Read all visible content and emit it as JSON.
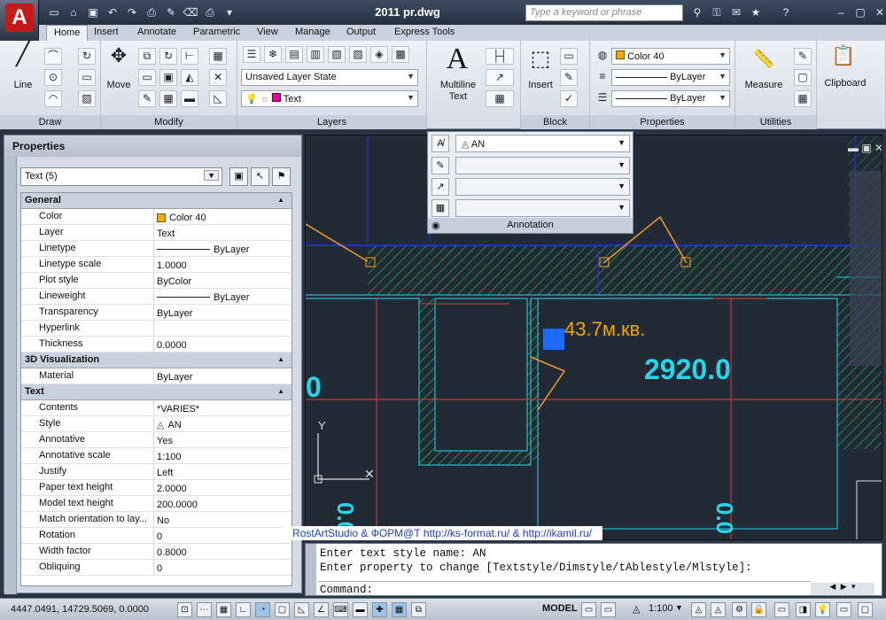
{
  "title": {
    "doc": "2011 pr.dwg",
    "search_placeholder": "Type a keyword or phrase"
  },
  "tabs": [
    {
      "label": "Home",
      "active": true
    },
    {
      "label": "Insert"
    },
    {
      "label": "Annotate"
    },
    {
      "label": "Parametric"
    },
    {
      "label": "View"
    },
    {
      "label": "Manage"
    },
    {
      "label": "Output"
    },
    {
      "label": "Express Tools"
    }
  ],
  "ribbon": {
    "draw": {
      "title": "Draw",
      "line_label": "Line"
    },
    "modify": {
      "title": "Modify",
      "move_label": "Move"
    },
    "layers": {
      "title": "Layers",
      "layer_state": "Unsaved Layer State",
      "current_layer": "Text",
      "current_layer_color": "#e000a0"
    },
    "annotation": {
      "multiline_label_1": "Multiline",
      "multiline_label_2": "Text"
    },
    "block": {
      "title": "Block",
      "insert_label": "Insert"
    },
    "properties": {
      "title": "Properties",
      "color": "Color 40",
      "color_swatch": "#f0a800",
      "linetype": "ByLayer",
      "lineweight": "ByLayer"
    },
    "utilities": {
      "title": "Utilities",
      "measure_label": "Measure"
    },
    "clipboard": {
      "title": "Clipboard"
    }
  },
  "annotation_panel": {
    "title": "Annotation",
    "text_style": "AN",
    "rows": [
      "AN",
      "",
      "",
      ""
    ]
  },
  "properties_palette": {
    "title": "Properties",
    "selection": "Text (5)",
    "sections": [
      {
        "name": "General",
        "rows": [
          {
            "k": "Color",
            "v": "Color 40",
            "swatch": true
          },
          {
            "k": "Layer",
            "v": "Text"
          },
          {
            "k": "Linetype",
            "v": "ByLayer",
            "line": true
          },
          {
            "k": "Linetype scale",
            "v": "1.0000"
          },
          {
            "k": "Plot style",
            "v": "ByColor"
          },
          {
            "k": "Lineweight",
            "v": "ByLayer",
            "line": true
          },
          {
            "k": "Transparency",
            "v": "ByLayer"
          },
          {
            "k": "Hyperlink",
            "v": ""
          },
          {
            "k": "Thickness",
            "v": "0.0000"
          }
        ]
      },
      {
        "name": "3D Visualization",
        "rows": [
          {
            "k": "Material",
            "v": "ByLayer"
          }
        ]
      },
      {
        "name": "Text",
        "rows": [
          {
            "k": "Contents",
            "v": "*VARIES*"
          },
          {
            "k": "Style",
            "v": "AN",
            "anno": true
          },
          {
            "k": "Annotative",
            "v": "Yes"
          },
          {
            "k": "Annotative scale",
            "v": "1:100"
          },
          {
            "k": "Justify",
            "v": "Left"
          },
          {
            "k": "Paper text height",
            "v": "2.0000"
          },
          {
            "k": "Model text height",
            "v": "200.0000"
          },
          {
            "k": "Match orientation to lay...",
            "v": "No"
          },
          {
            "k": "Rotation",
            "v": "0"
          },
          {
            "k": "Width factor",
            "v": "0.8000"
          },
          {
            "k": "Obliquing",
            "v": "0"
          }
        ]
      }
    ]
  },
  "drawing": {
    "area_text": "43.7м.кв.",
    "dim_text": "2920.0",
    "left_dim": "0",
    "bottom_dim_1": "0.0",
    "bottom_dim_2": "0.0",
    "ucs_y": "Y"
  },
  "watermark": "RostArtStudio & ФОРМ@Т http://ks-format.ru/ & http://ikamil.ru/",
  "command": {
    "lines": [
      "Enter text style name: AN",
      "Enter property to change [Textstyle/Dimstyle/tAblestyle/Mlstyle]:"
    ],
    "prompt": "Command:"
  },
  "status": {
    "coords": "4447.0491, 14729.5069, 0.0000",
    "model": "MODEL",
    "scale": "1:100"
  }
}
